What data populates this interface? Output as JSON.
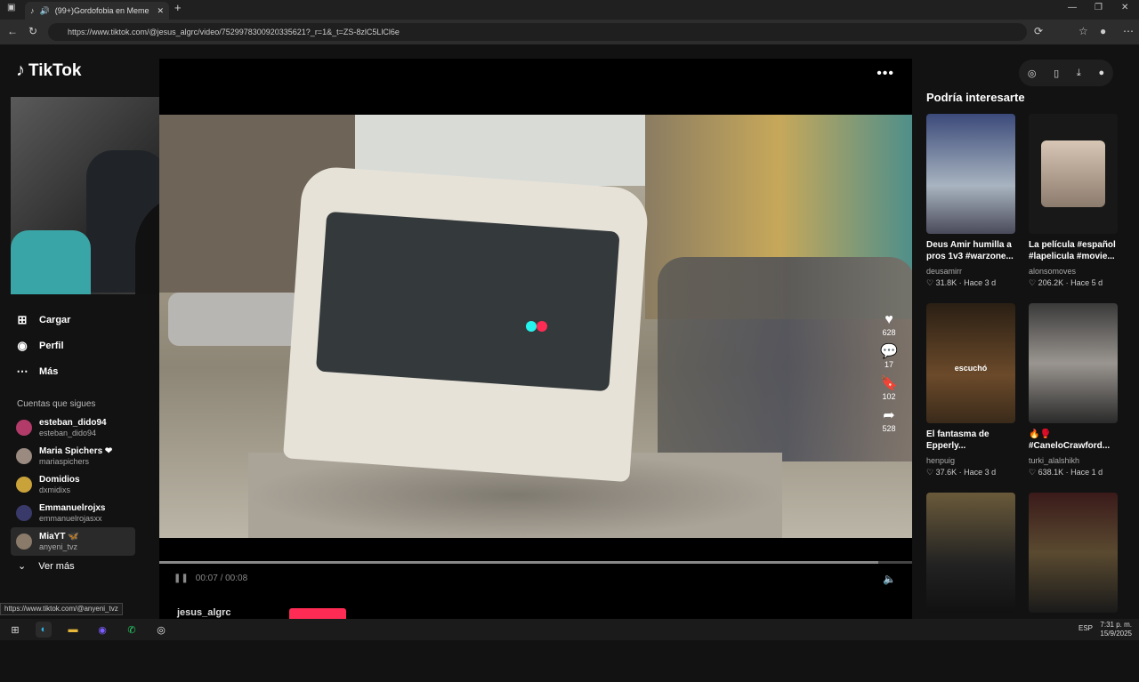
{
  "browser": {
    "tab_title": "(99+)Gordofobia en Meme",
    "url": "https://www.tiktok.com/@jesus_algrc/video/7529978300920335621?_r=1&_t=ZS-8zlC5LlCl6e",
    "status_url": "https://www.tiktok.com/@anyeni_tvz"
  },
  "tiktok": {
    "logo": "TikTok",
    "nav": [
      {
        "icon": "plus-square-icon",
        "label": "Cargar"
      },
      {
        "icon": "profile-avatar-icon",
        "label": "Perfil"
      },
      {
        "icon": "more-dots-icon",
        "label": "Más"
      }
    ],
    "following_title": "Cuentas que sigues",
    "following": [
      {
        "name": "esteban_dido94",
        "handle": "esteban_dido94"
      },
      {
        "name": "Maria Spichers ❤",
        "handle": "mariaspichers"
      },
      {
        "name": "Domidios",
        "handle": "dxmidixs"
      },
      {
        "name": "Emmanuelrojxs",
        "handle": "emmanuelrojasxx"
      },
      {
        "name": "MiaYT 🦋",
        "handle": "anyeni_tvz"
      }
    ],
    "see_more": "Ver más"
  },
  "player": {
    "time": "00:07 / 00:08",
    "progress": 0.955,
    "author": "jesus_algrc",
    "actions": [
      {
        "icon": "heart-icon",
        "count": "628"
      },
      {
        "icon": "comment-icon",
        "count": "17"
      },
      {
        "icon": "bookmark-icon",
        "count": "102"
      },
      {
        "icon": "share-icon",
        "count": "528"
      }
    ]
  },
  "recommendations": {
    "title": "Podría interesarte",
    "items": [
      {
        "caption": "Deus Amir humilla a pros 1v3 #warzone...",
        "user": "deusamirr",
        "likes": "31.8K",
        "when": "Hace 3 d",
        "thumb_text": ""
      },
      {
        "caption": "La película #español #lapelicula #movie...",
        "user": "alonsomoves",
        "likes": "206.2K",
        "when": "Hace 5 d",
        "thumb_text": ""
      },
      {
        "caption": "El fantasma de Epperly...",
        "user": "henpuig",
        "likes": "37.6K",
        "when": "Hace 3 d",
        "thumb_text": "escuchó"
      },
      {
        "caption": "🔥🥊 #CaneloCrawford...",
        "user": "turki_alalshikh",
        "likes": "638.1K",
        "when": "Hace 1 d",
        "thumb_text": ""
      },
      {
        "caption": "",
        "user": "",
        "likes": "",
        "when": "",
        "thumb_text": ""
      },
      {
        "caption": "",
        "user": "",
        "likes": "",
        "when": "",
        "thumb_text": ""
      }
    ]
  },
  "taskbar": {
    "lang": "ESP",
    "time": "7:31 p. m.",
    "date": "15/9/2025"
  }
}
